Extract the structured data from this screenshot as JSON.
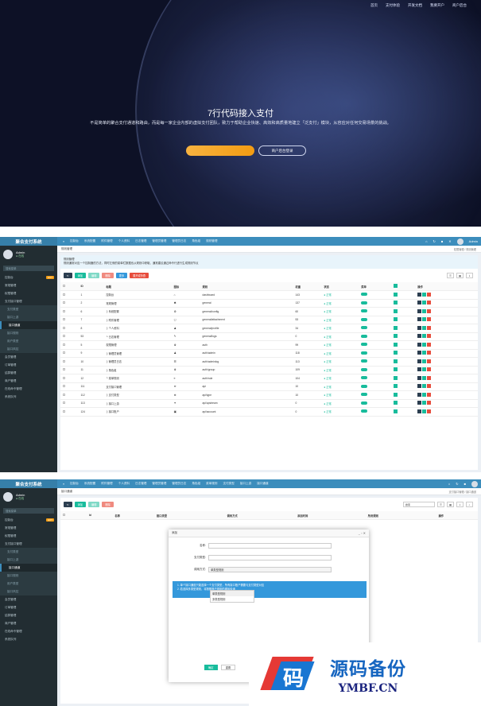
{
  "landing": {
    "nav": [
      "首页",
      "支付体验",
      "开发文档",
      "我要开户",
      "商户后台"
    ],
    "title": "7行代码接入支付",
    "subtitle": "不是简单的聚合支付通道和路由，而是每一家企业内部的虚拟支付团队，致力于帮助企业快速、高效和高质量地建立「泛支付」模块，从容应对任何交易场景的挑战。",
    "primary_button": "",
    "secondary_button": "商户后台登录"
  },
  "admin": {
    "brand": "聚合支付系统",
    "user": {
      "name": "Admin",
      "status": "在线"
    },
    "search_placeholder": "搜索菜单",
    "top_tabs_1": [
      "控制台",
      "系统配置",
      "附件管理",
      "个人资料",
      "日志管理",
      "管理员管理",
      "管理员日志",
      "角色组",
      "规则管理"
    ],
    "top_tabs_2": [
      "控制台",
      "系统配置",
      "附件管理",
      "个人资料",
      "日志管理",
      "管理员管理",
      "管理员日志",
      "角色组",
      "菜单规则",
      "支付类型",
      "接口上游",
      "接口通道"
    ],
    "sidebar": [
      {
        "label": "控制台",
        "badge": "HOT"
      },
      {
        "label": "常规管理"
      },
      {
        "label": "权限管理"
      },
      {
        "label": "支付接口管理"
      },
      {
        "label": "支付类型",
        "sub": true
      },
      {
        "label": "接口上游",
        "sub": true
      },
      {
        "label": "接口通道",
        "sub": true,
        "active": true
      },
      {
        "label": "接口规则",
        "sub": true
      },
      {
        "label": "用户类型",
        "sub": true
      },
      {
        "label": "接口风控",
        "sub": true
      },
      {
        "label": "会员管理"
      },
      {
        "label": "订单管理"
      },
      {
        "label": "结算管理"
      },
      {
        "label": "商户管理"
      },
      {
        "label": "在线命令管理"
      },
      {
        "label": "系统队列"
      }
    ],
    "crumb_1": "规则管理",
    "crumb_1_right": "权限管理 / 规则管理",
    "desc_title": "规则管理",
    "desc_text": "规则通常对应一个控制器的方法，同时左侧的菜单栏数据也从规则中获取，通常建议通过命令行进行生成规则节点",
    "buttons_1": [
      "添加",
      "编辑",
      "删除",
      "更多",
      "展开或折叠"
    ],
    "table_headers": [
      "ID",
      "标题",
      "图标",
      "规则",
      "权重",
      "状态",
      "菜单",
      "",
      "操作"
    ],
    "rows": [
      {
        "id": "1",
        "title": "控制台",
        "rule": "dashboard",
        "weight": "143"
      },
      {
        "id": "2",
        "title": "常规管理",
        "rule": "general",
        "weight": "137"
      },
      {
        "id": "6",
        "title": "├ 系统配置",
        "rule": "general/config",
        "weight": "60"
      },
      {
        "id": "7",
        "title": "├ 附件管理",
        "rule": "general/attachment",
        "weight": "53"
      },
      {
        "id": "8",
        "title": "├ 个人资料",
        "rule": "general/profile",
        "weight": "34"
      },
      {
        "id": "53",
        "title": "└ 日志管理",
        "rule": "general/logs",
        "weight": "0"
      },
      {
        "id": "5",
        "title": "权限管理",
        "rule": "auth",
        "weight": "99"
      },
      {
        "id": "9",
        "title": "├ 管理员管理",
        "rule": "auth/admin",
        "weight": "118"
      },
      {
        "id": "10",
        "title": "├ 管理员日志",
        "rule": "auth/adminlog",
        "weight": "113"
      },
      {
        "id": "11",
        "title": "├ 角色组",
        "rule": "auth/group",
        "weight": "109"
      },
      {
        "id": "12",
        "title": "└ 菜单规则",
        "rule": "auth/rule",
        "weight": "104"
      },
      {
        "id": "111",
        "title": "支付接口管理",
        "rule": "api",
        "weight": "10"
      },
      {
        "id": "112",
        "title": "├ 支付类型",
        "rule": "api/type",
        "weight": "10"
      },
      {
        "id": "113",
        "title": "├ 接口上游",
        "rule": "api/upstream",
        "weight": "0"
      },
      {
        "id": "124",
        "title": "├ 接口账户",
        "rule": "api/account",
        "weight": "0"
      }
    ],
    "status_label": "正常",
    "crumb_2": "接口通道",
    "crumb_2_right": "支付接口管理 / 接口通道",
    "buttons_2": [
      "添加",
      "编辑",
      "删除"
    ],
    "search2": "搜索",
    "table2_headers": [
      "Id",
      "名称",
      "接口类型",
      "调用方式",
      "添加时间",
      "所用规则",
      "操作"
    ],
    "dialog": {
      "title": "添加",
      "fields": [
        {
          "label": "名称:",
          "value": ""
        },
        {
          "label": "支付类型:",
          "value": ""
        },
        {
          "label": "调用方式:",
          "value": "单类型规则"
        }
      ],
      "dropdown": [
        "单类型规则",
        "单类型规则",
        "多类型规则"
      ],
      "tips": [
        "1. 单个接口通道只能选择一个支付类型，所有接口账户需要与支付类型对应",
        "2. 若选择多类型规则，将按照账户规则的顺序轮询"
      ],
      "ok": "确定",
      "reset": "重置"
    }
  },
  "watermark": {
    "glyph": "码",
    "title": "源码备份",
    "domain": "YMBF.CN"
  }
}
